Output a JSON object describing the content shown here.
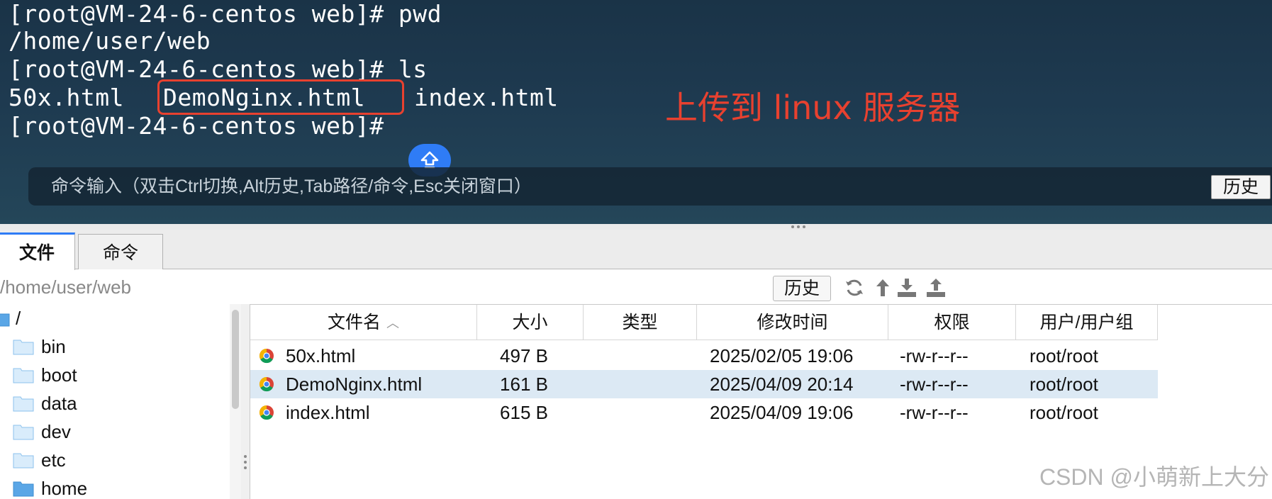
{
  "terminal": {
    "lines": [
      "[root@VM-24-6-centos web]# pwd",
      "/home/user/web",
      "[root@VM-24-6-centos web]# ls"
    ],
    "ls_output": [
      "50x.html",
      "DemoNginx.html",
      "index.html"
    ],
    "prompt": "[root@VM-24-6-centos web]#",
    "annotation": "上传到 linux 服务器",
    "command_input": {
      "placeholder": "命令输入（双击Ctrl切换,Alt历史,Tab路径/命令,Esc关闭窗口）",
      "history_label": "历史"
    },
    "accent_color": "#e8412f",
    "fab_icon": "upload-arrow-icon"
  },
  "file_manager": {
    "tabs": [
      {
        "label": "文件",
        "active": true
      },
      {
        "label": "命令",
        "active": false
      }
    ],
    "path": "/home/user/web",
    "history_label": "历史",
    "toolbar_icons": [
      "refresh-icon",
      "go-up-icon",
      "download-icon",
      "upload-icon"
    ],
    "tree": {
      "root": "/",
      "items": [
        "bin",
        "boot",
        "data",
        "dev",
        "etc",
        "home"
      ]
    },
    "columns": [
      "文件名",
      "大小",
      "类型",
      "修改时间",
      "权限",
      "用户/用户组"
    ],
    "files": [
      {
        "name": "50x.html",
        "size": "497 B",
        "type": "",
        "mtime": "2025/02/05 19:06",
        "perm": "-rw-r--r--",
        "owner": "root/root",
        "selected": false
      },
      {
        "name": "DemoNginx.html",
        "size": "161 B",
        "type": "",
        "mtime": "2025/04/09 20:14",
        "perm": "-rw-r--r--",
        "owner": "root/root",
        "selected": true
      },
      {
        "name": "index.html",
        "size": "615 B",
        "type": "",
        "mtime": "2025/04/09 19:06",
        "perm": "-rw-r--r--",
        "owner": "root/root",
        "selected": false
      }
    ],
    "selection_color": "#dce9f4"
  },
  "watermark": "CSDN @小萌新上大分"
}
